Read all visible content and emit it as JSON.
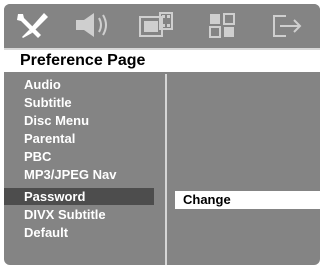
{
  "toolbar": {
    "icons": [
      "settings-tools-icon",
      "audio-speaker-icon",
      "video-film-icon",
      "preference-grid-icon",
      "exit-icon"
    ]
  },
  "page": {
    "title": "Preference Page"
  },
  "menu": {
    "items": [
      {
        "label": "Audio"
      },
      {
        "label": "Subtitle"
      },
      {
        "label": "Disc Menu"
      },
      {
        "label": "Parental"
      },
      {
        "label": "PBC"
      },
      {
        "label": "MP3/JPEG Nav"
      },
      {
        "label": "Password"
      },
      {
        "label": "DIVX Subtitle"
      },
      {
        "label": "Default"
      }
    ],
    "selected_index": 6
  },
  "submenu": {
    "option_label": "Change"
  },
  "colors": {
    "background": "#848484",
    "highlight_left": "#4d4d4d",
    "highlight_right": "#ffffff",
    "text_light": "#ffffff",
    "text_dark": "#000000"
  }
}
